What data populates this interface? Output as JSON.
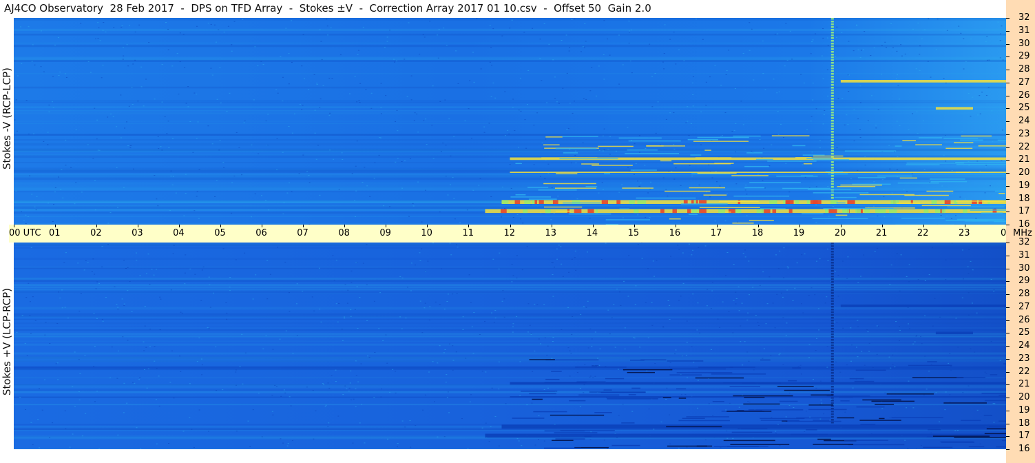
{
  "chart_data": {
    "type": "heatmap",
    "title": "AJ4CO Observatory  28 Feb 2017  -  DPS on TFD Array  -  Stokes ±V  -  Correction Array 2017 01 10.csv  -  Offset 50  Gain 2.0",
    "xlabel": "UTC",
    "x_unit_tick": "00 UTC",
    "xlim": [
      0,
      24
    ],
    "x_ticks": [
      "00 UTC",
      "01",
      "02",
      "03",
      "04",
      "05",
      "06",
      "07",
      "08",
      "09",
      "10",
      "11",
      "12",
      "13",
      "14",
      "15",
      "16",
      "17",
      "18",
      "19",
      "20",
      "21",
      "22",
      "23",
      "00"
    ],
    "y_unit": "MHz",
    "ylim": [
      16,
      32
    ],
    "y_ticks": [
      "16",
      "17",
      "18",
      "19",
      "20",
      "21",
      "22",
      "23",
      "24",
      "25",
      "26",
      "27",
      "28",
      "29",
      "30",
      "31",
      "32"
    ],
    "panels": [
      {
        "name": "Stokes -V (RCP-LCP)",
        "ylabel": "Stokes -V  (RCP-LCP)",
        "features": [
          {
            "kind": "vertical-burst",
            "x": 19.8,
            "y": [
              18,
              32
            ]
          },
          {
            "kind": "band",
            "x": [
              11.4,
              24
            ],
            "y": [
              16.9,
              17.2
            ]
          },
          {
            "kind": "band",
            "x": [
              11.8,
              24
            ],
            "y": [
              17.6,
              17.9
            ]
          },
          {
            "kind": "band",
            "x": [
              12,
              24
            ],
            "y": [
              20.0,
              20.1
            ]
          },
          {
            "kind": "band",
            "x": [
              12,
              24
            ],
            "y": [
              21.0,
              21.2
            ]
          },
          {
            "kind": "band",
            "x": [
              20,
              24
            ],
            "y": [
              27.0,
              27.2
            ]
          },
          {
            "kind": "band",
            "x": [
              22.3,
              23.2
            ],
            "y": [
              24.9,
              25.1
            ]
          }
        ]
      },
      {
        "name": "Stokes +V (LCP-RCP)",
        "ylabel": "Stokes +V  (LCP-RCP)",
        "features": [
          {
            "kind": "vertical-burst",
            "x": 19.8,
            "y": [
              18,
              32
            ]
          },
          {
            "kind": "band",
            "x": [
              11.4,
              24
            ],
            "y": [
              16.9,
              17.2
            ]
          },
          {
            "kind": "band",
            "x": [
              11.8,
              24
            ],
            "y": [
              17.6,
              17.9
            ]
          },
          {
            "kind": "band",
            "x": [
              12,
              24
            ],
            "y": [
              20.0,
              20.1
            ]
          },
          {
            "kind": "band",
            "x": [
              12,
              24
            ],
            "y": [
              21.0,
              21.2
            ]
          },
          {
            "kind": "band",
            "x": [
              20,
              24
            ],
            "y": [
              27.0,
              27.2
            ]
          },
          {
            "kind": "band",
            "x": [
              22.3,
              23.2
            ],
            "y": [
              24.9,
              25.1
            ]
          }
        ]
      }
    ],
    "colors": {
      "background": "#1a6ee6",
      "dark": "#0a3fb8",
      "bright": "#2fb4f0",
      "hot": "#f5e13c",
      "hotter": "#e4462e",
      "time_axis_bg": "#ffffc8",
      "freq_strip_bg": "#ffdcb4"
    }
  }
}
